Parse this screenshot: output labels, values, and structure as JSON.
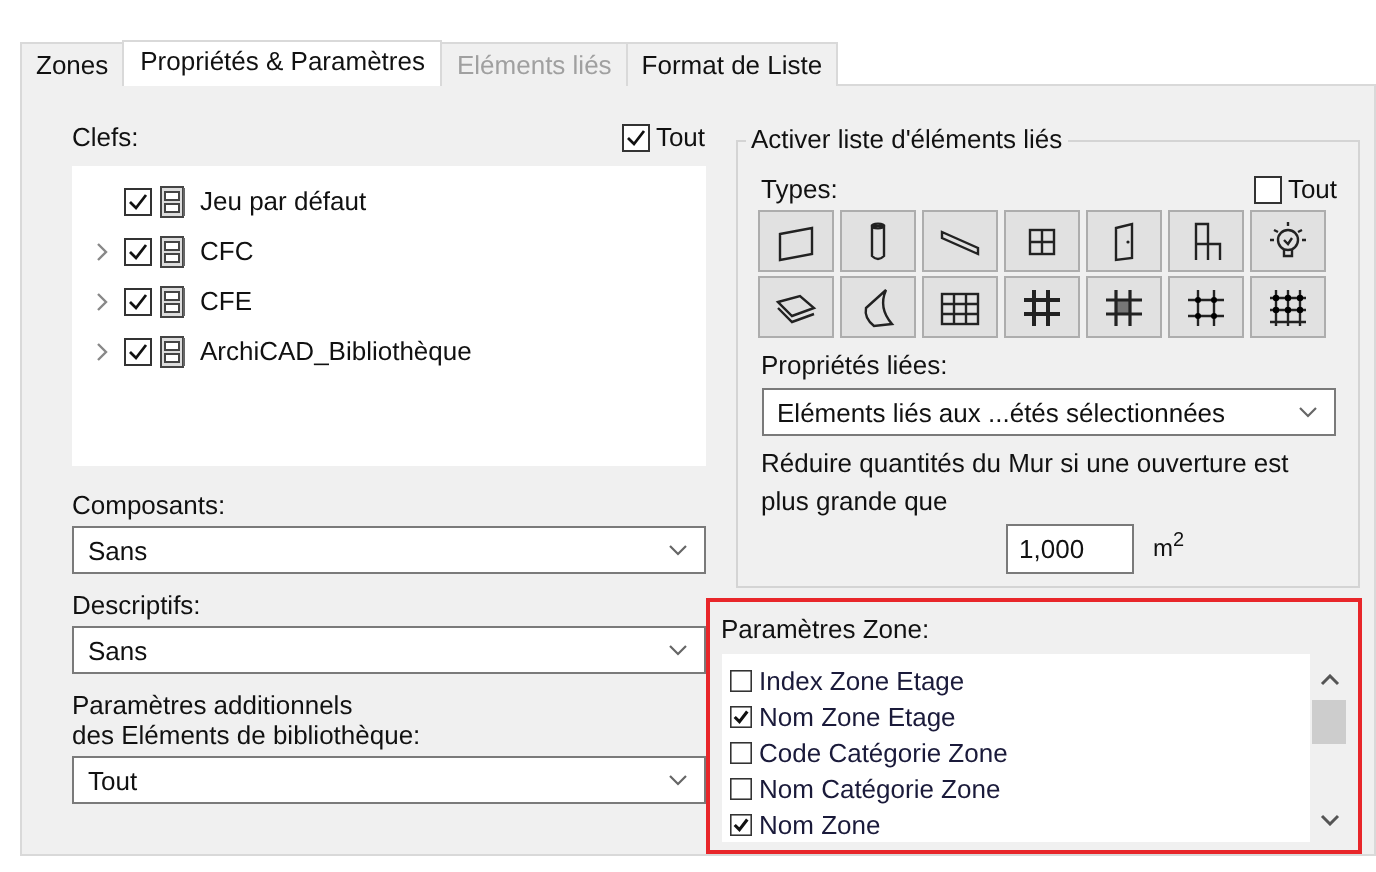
{
  "tabs": [
    {
      "label": "Zones",
      "selected": false,
      "disabled": false
    },
    {
      "label": "Propriétés & Paramètres",
      "selected": true,
      "disabled": false
    },
    {
      "label": "Eléments liés",
      "selected": false,
      "disabled": true
    },
    {
      "label": "Format de Liste",
      "selected": false,
      "disabled": false
    }
  ],
  "keys": {
    "label": "Clefs:",
    "all": {
      "label": "Tout",
      "checked": true
    },
    "items": [
      {
        "label": "Jeu par défaut",
        "checked": true,
        "expandable": false
      },
      {
        "label": "CFC",
        "checked": true,
        "expandable": true
      },
      {
        "label": "CFE",
        "checked": true,
        "expandable": true
      },
      {
        "label": "ArchiCAD_Bibliothèque",
        "checked": true,
        "expandable": true
      }
    ]
  },
  "dropdowns": [
    {
      "label": "Composants:",
      "value": "Sans"
    },
    {
      "label": "Descriptifs:",
      "value": "Sans"
    },
    {
      "label": "Paramètres additionnels\ndes Eléments de bibliothèque:",
      "value": "Tout"
    }
  ],
  "linked": {
    "title": "Activer liste d'éléments liés",
    "types_label": "Types:",
    "all": {
      "label": "Tout",
      "checked": false
    },
    "properties_label": "Propriétés liées:",
    "properties_value": "Eléments liés aux ...étés sélectionnées",
    "reduce_text": "Réduire quantités du Mur si une ouverture est plus grande que",
    "area_value": "1,000",
    "area_unit": "m$^{2}$"
  },
  "zone_params": {
    "label": "Paramètres Zone:",
    "items": [
      {
        "label": "Index Zone Etage",
        "checked": false
      },
      {
        "label": "Nom Zone Etage",
        "checked": true
      },
      {
        "label": "Code Catégorie Zone",
        "checked": false
      },
      {
        "label": "Nom Catégorie Zone",
        "checked": false
      },
      {
        "label": "Nom Zone",
        "checked": true
      }
    ]
  }
}
